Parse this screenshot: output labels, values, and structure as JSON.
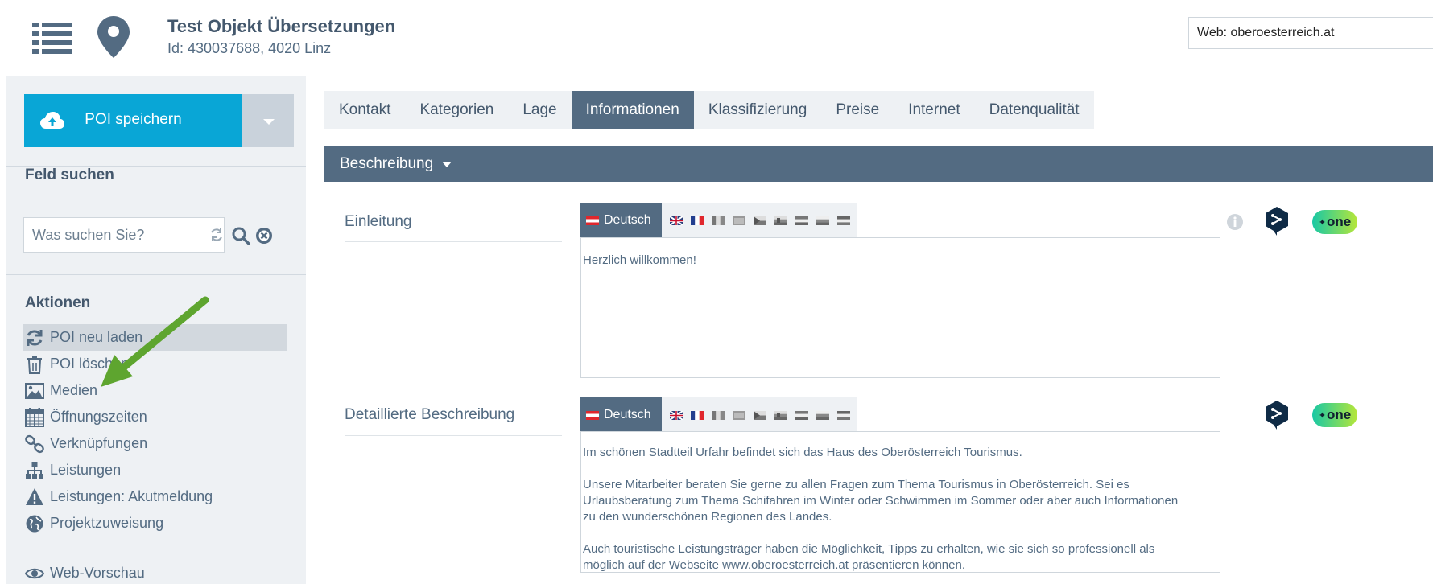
{
  "header": {
    "title": "Test Objekt Übersetzungen",
    "subtitle": "Id: 430037688, 4020 Linz",
    "web_select": "Web: oberoesterreich.at"
  },
  "sidebar": {
    "save_label": "POI speichern",
    "search_heading": "Feld suchen",
    "search_placeholder": "Was suchen Sie?",
    "actions_heading": "Aktionen",
    "actions": [
      {
        "label": "POI neu laden",
        "icon": "refresh-icon"
      },
      {
        "label": "POI löschen",
        "icon": "trash-icon"
      },
      {
        "label": "Medien",
        "icon": "image-icon"
      },
      {
        "label": "Öffnungszeiten",
        "icon": "calendar-icon"
      },
      {
        "label": "Verknüpfungen",
        "icon": "link-icon"
      },
      {
        "label": "Leistungen",
        "icon": "sitemap-icon"
      },
      {
        "label": "Leistungen: Akutmeldung",
        "icon": "warning-icon"
      },
      {
        "label": "Projektzuweisung",
        "icon": "globe-icon"
      },
      {
        "label": "Web-Vorschau",
        "icon": "eye-icon"
      }
    ]
  },
  "tabs": [
    "Kontakt",
    "Kategorien",
    "Lage",
    "Informationen",
    "Klassifizierung",
    "Preise",
    "Internet",
    "Datenqualität"
  ],
  "active_tab": "Informationen",
  "section": {
    "label": "Beschreibung"
  },
  "fields": [
    {
      "label": "Einleitung",
      "lang_label": "Deutsch",
      "text": [
        "Herzlich willkommen!"
      ]
    },
    {
      "label": "Detaillierte Beschreibung",
      "lang_label": "Deutsch",
      "text": [
        "Im schönen Stadtteil Urfahr befindet sich das Haus des Oberösterreich Tourismus.",
        "Unsere Mitarbeiter beraten Sie gerne zu allen Fragen zum Thema Tourismus in Oberösterreich. Sei es\nUrlaubsberatung zum Thema Schifahren im Winter oder Schwimmen im Sommer oder aber auch Informationen\nzu den wunderschönen Regionen des Landes.",
        "Auch touristische Leistungsträger haben die Möglichkeit, Tipps zu erhalten, wie sie sich so professionell als\nmöglich auf der Webseite www.oberoesterreich.at präsentieren können."
      ]
    }
  ],
  "tools": {
    "one_label": "one"
  },
  "colors": {
    "accent": "#09a6d6",
    "primary": "#536b82",
    "arrow": "#5ea52f"
  }
}
